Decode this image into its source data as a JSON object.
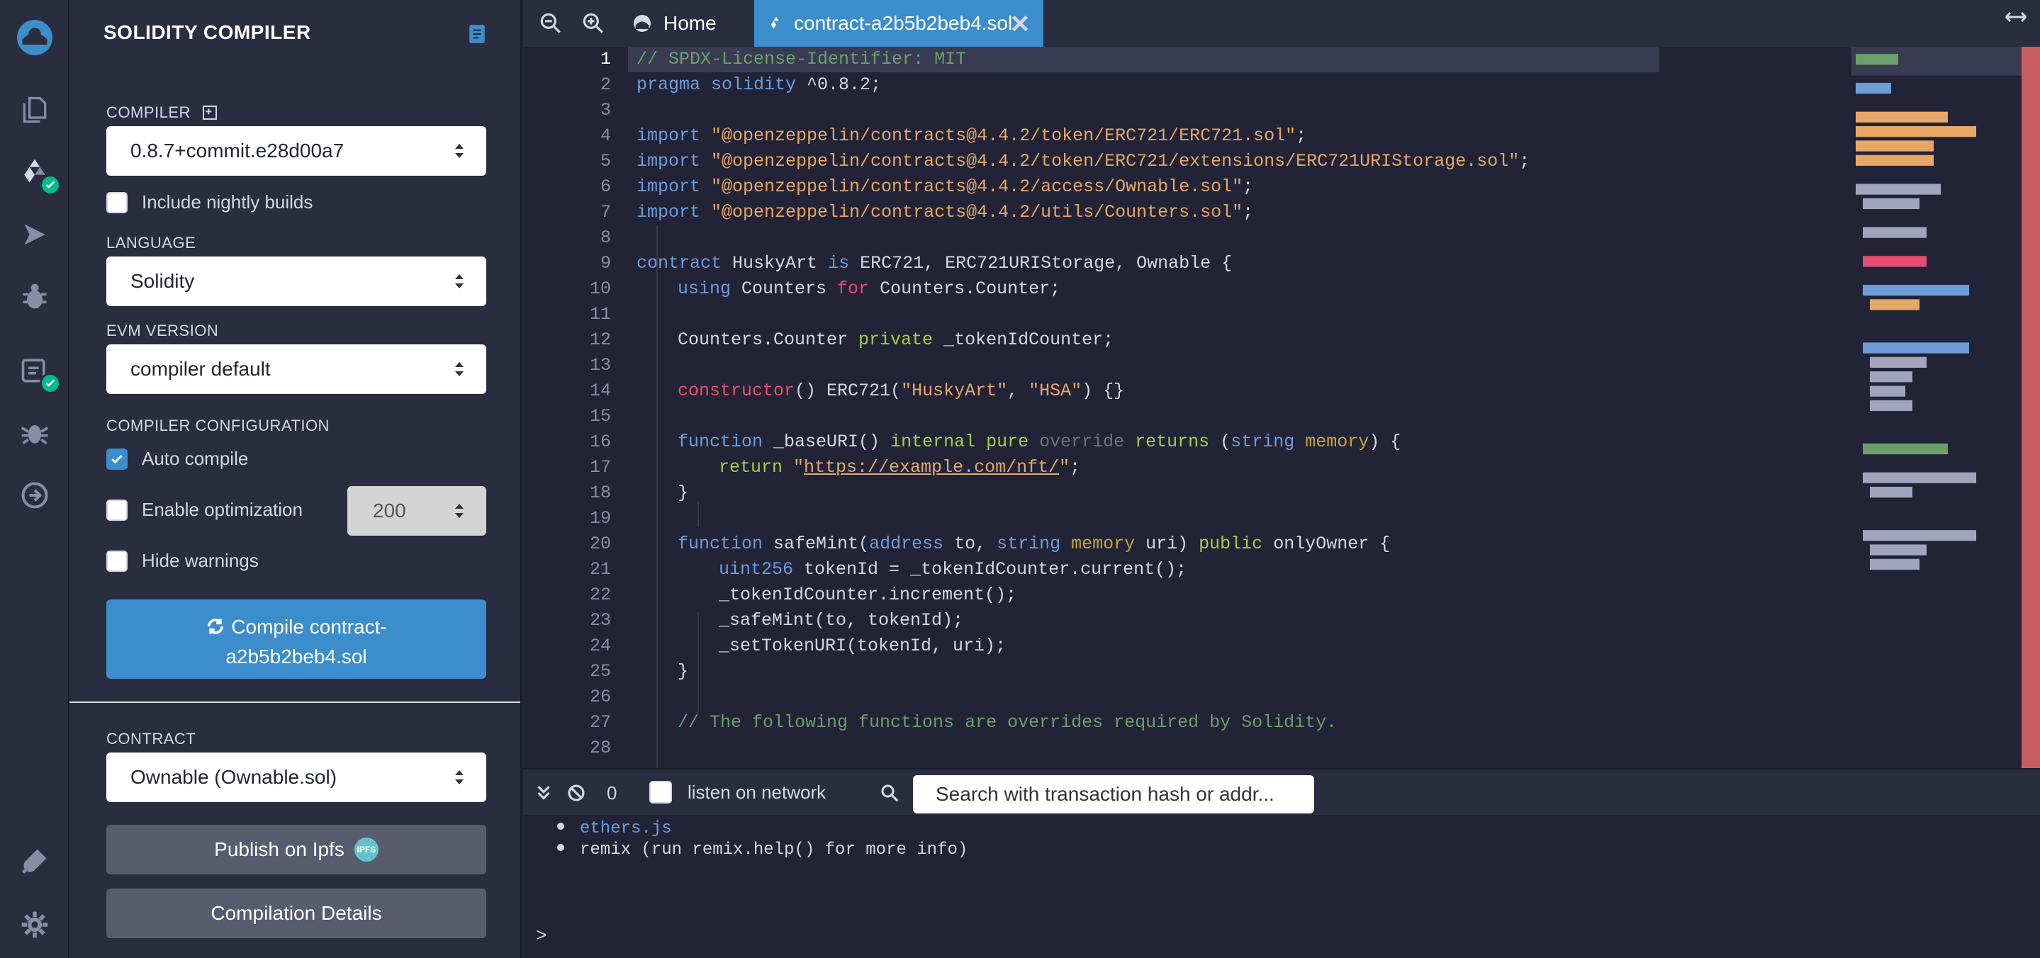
{
  "side_panel": {
    "title": "SOLIDITY COMPILER",
    "compiler_label": "COMPILER",
    "compiler_value": "0.8.7+commit.e28d00a7",
    "nightly_label": "Include nightly builds",
    "language_label": "LANGUAGE",
    "language_value": "Solidity",
    "evm_label": "EVM VERSION",
    "evm_value": "compiler default",
    "config_label": "COMPILER CONFIGURATION",
    "auto_compile_label": "Auto compile",
    "optimization_label": "Enable optimization",
    "runs_value": "200",
    "hide_warnings_label": "Hide warnings",
    "compile_button_line1": "Compile contract-",
    "compile_button_line2": "a2b5b2beb4.sol",
    "contract_label": "CONTRACT",
    "contract_value": "Ownable (Ownable.sol)",
    "publish_label": "Publish on Ipfs",
    "ipfs_badge": "IPFS",
    "details_label": "Compilation Details"
  },
  "tabs": {
    "home": "Home",
    "active": "contract-a2b5b2beb4.sol"
  },
  "editor": {
    "line_numbers": [
      "1",
      "2",
      "3",
      "4",
      "5",
      "6",
      "7",
      "8",
      "9",
      "10",
      "11",
      "12",
      "13",
      "14",
      "15",
      "16",
      "17",
      "18",
      "19",
      "20",
      "21",
      "22",
      "23",
      "24",
      "25",
      "26",
      "27",
      "28"
    ],
    "lines": {
      "l1": "// SPDX-License-Identifier: MIT",
      "l2_kw": "pragma solidity",
      "l2_rest": " ^0.8.2;",
      "l4_kw": "import",
      "l4_str": " \"@openzeppelin/contracts@4.4.2/token/ERC721/ERC721.sol\"",
      "l5_kw": "import",
      "l5_str": " \"@openzeppelin/contracts@4.4.2/token/ERC721/extensions/ERC721URIStorage.sol\"",
      "l6_kw": "import",
      "l6_str": " \"@openzeppelin/contracts@4.4.2/access/Ownable.sol\"",
      "l7_kw": "import",
      "l7_str": " \"@openzeppelin/contracts@4.4.2/utils/Counters.sol\"",
      "semi": ";",
      "l9_kw1": "contract",
      "l9_name": " HuskyArt ",
      "l9_kw2": "is",
      "l9_rest": " ERC721, ERC721URIStorage, Ownable {",
      "l10_kw": "using",
      "l10_a": " Counters ",
      "l10_for": "for",
      "l10_b": " Counters.Counter;",
      "l12_a": "Counters.Counter ",
      "l12_kw": "private",
      "l12_b": " _tokenIdCounter;",
      "l14_kw": "constructor",
      "l14_a": "() ERC721(",
      "l14_s1": "\"HuskyArt\"",
      "l14_comma": ", ",
      "l14_s2": "\"HSA\"",
      "l14_b": ") {}",
      "l16_fn": "function",
      "l16_a": " _baseURI() ",
      "l16_internal": "internal",
      "l16_pure": " pure",
      "l16_override": " override",
      "l16_returns": " returns",
      "l16_b": " (",
      "l16_string": "string",
      "l16_memory": " memory",
      "l16_c": ") {",
      "l17_kw": "return",
      "l17_q1": " \"",
      "l17_url": "https://example.com/nft/",
      "l17_q2": "\"",
      "l18": "}",
      "l20_fn": "function",
      "l20_a": " safeMint(",
      "l20_address": "address",
      "l20_b": " to, ",
      "l20_string": "string",
      "l20_memory": " memory",
      "l20_c": " uri) ",
      "l20_public": "public",
      "l20_d": " onlyOwner {",
      "l21_kw": "uint256",
      "l21_rest": " tokenId = _tokenIdCounter.current();",
      "l22": "_tokenIdCounter.increment();",
      "l23": "_safeMint(to, tokenId);",
      "l24": "_setTokenURI(tokenId, uri);",
      "l25": "}",
      "l27": "// The following functions are overrides required by Solidity."
    }
  },
  "terminal": {
    "count": "0",
    "listen_label": "listen on network",
    "search_placeholder": "Search with transaction hash or addr...",
    "line1": "ethers.js",
    "line2": "remix (run remix.help() for more info)",
    "prompt": ">"
  },
  "icons": [
    "remix-logo-icon",
    "file-explorer-icon",
    "solidity-compiler-icon",
    "deploy-run-icon",
    "debugger-icon",
    "testing-icon",
    "bug-icon",
    "git-icon",
    "plugin-manager-icon",
    "settings-icon",
    "doc-icon",
    "zoom-out-icon",
    "zoom-in-icon",
    "home-icon",
    "close-icon",
    "expand-icon",
    "collapse-terminal-icon",
    "clear-console-icon",
    "search-icon",
    "refresh-icon"
  ],
  "colors": {
    "accent": "#3c8dcb",
    "success": "#00bc8c",
    "panel": "#2a2c3f",
    "editor": "#222336"
  }
}
